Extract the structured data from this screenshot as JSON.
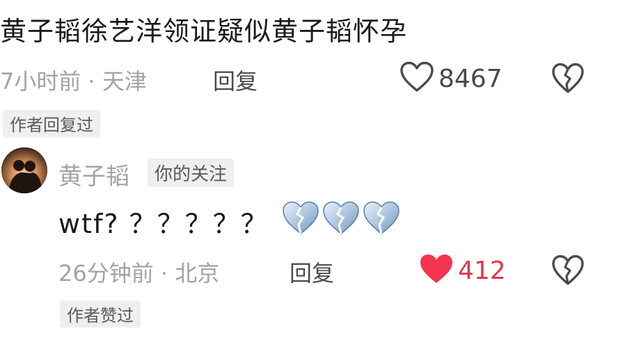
{
  "comment": {
    "text": "黄子韬徐艺洋领证疑似黄子韬怀孕",
    "meta": "7小时前 · 天津",
    "reply_label": "回复",
    "like_count": "8467",
    "badge": "作者回复过"
  },
  "reply": {
    "author": "黄子韬",
    "follow_badge": "你的关注",
    "text": "wtf? ？？？？？",
    "emojis": [
      "broken-heart-blue-icon",
      "broken-heart-blue-icon",
      "broken-heart-blue-icon"
    ],
    "meta": "26分钟前 · 北京",
    "reply_label": "回复",
    "like_count": "412",
    "badge": "作者赞过",
    "colors": {
      "liked_heart": "#f5344f",
      "liked_count": "#e0374e"
    }
  }
}
